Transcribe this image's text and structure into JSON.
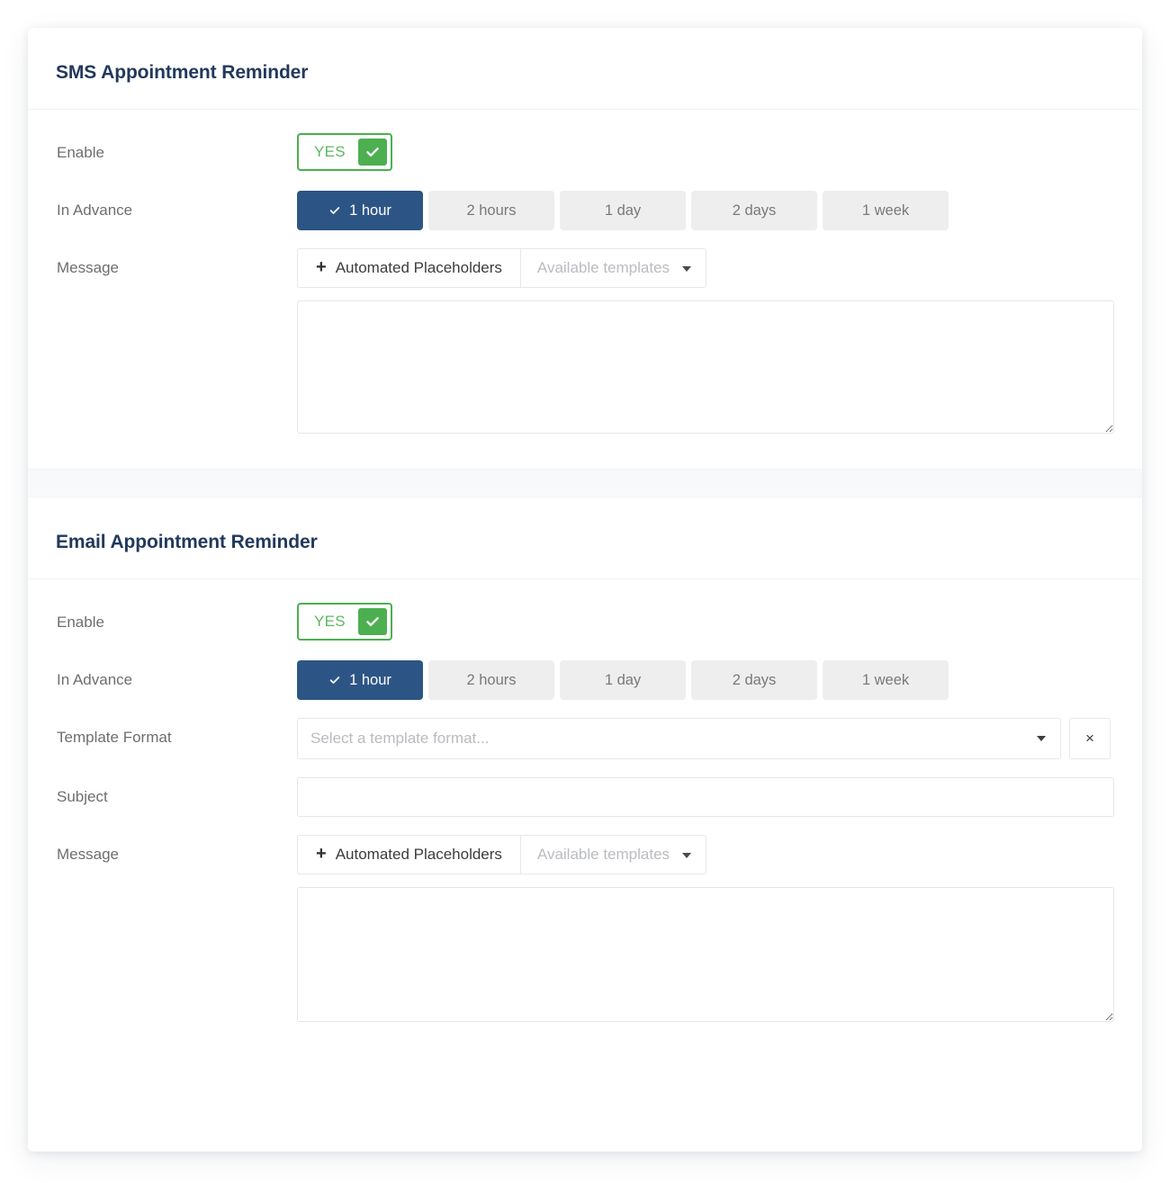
{
  "card": {
    "accent_navy": "#2c5585",
    "accent_green": "#4caf50",
    "title_color": "#21395c"
  },
  "sections": [
    {
      "id": "sms",
      "title": "SMS Appointment Reminder",
      "enable": {
        "label": "Enable",
        "value": "YES",
        "checked": true,
        "icon": "check-icon"
      },
      "in_advance": {
        "label": "In Advance",
        "selected": "1 hour",
        "options": [
          "1 hour",
          "2 hours",
          "1 day",
          "2 days",
          "1 week"
        ]
      },
      "message": {
        "label": "Message",
        "placeholders_button": "Automated Placeholders",
        "templates_button": "Available templates",
        "textarea_value": "",
        "textarea_placeholder": ""
      }
    },
    {
      "id": "email",
      "title": "Email Appointment Reminder",
      "enable": {
        "label": "Enable",
        "value": "YES",
        "checked": true,
        "icon": "check-icon"
      },
      "in_advance": {
        "label": "In Advance",
        "selected": "1 hour",
        "options": [
          "1 hour",
          "2 hours",
          "1 day",
          "2 days",
          "1 week"
        ]
      },
      "template_format": {
        "label": "Template Format",
        "value": "",
        "placeholder": "Select a template format...",
        "clear_label": "×",
        "options": []
      },
      "subject": {
        "label": "Subject",
        "value": "",
        "placeholder": ""
      },
      "message": {
        "label": "Message",
        "placeholders_button": "Automated Placeholders",
        "templates_button": "Available templates",
        "textarea_value": "",
        "textarea_placeholder": ""
      }
    }
  ]
}
